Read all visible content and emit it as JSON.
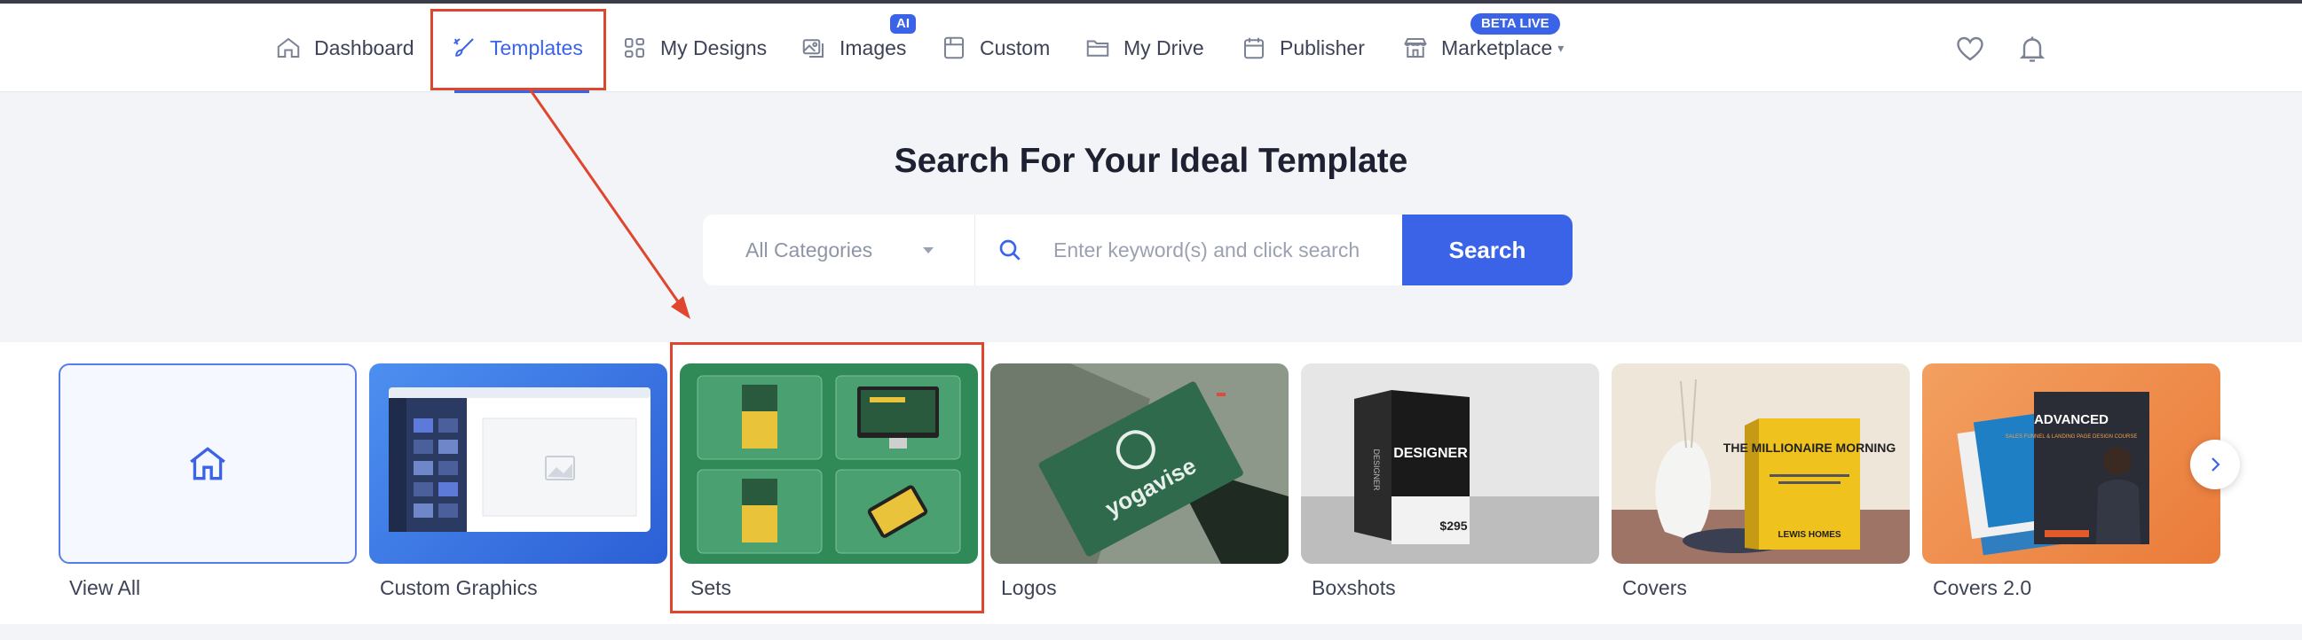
{
  "nav": {
    "items": [
      {
        "label": "Dashboard",
        "icon": "home-icon"
      },
      {
        "label": "Templates",
        "icon": "paint-brush-icon",
        "active": true
      },
      {
        "label": "My Designs",
        "icon": "grid-icon"
      },
      {
        "label": "Images",
        "icon": "images-icon",
        "badge": "AI"
      },
      {
        "label": "Custom",
        "icon": "custom-icon"
      },
      {
        "label": "My Drive",
        "icon": "folder-icon"
      },
      {
        "label": "Publisher",
        "icon": "calendar-icon"
      },
      {
        "label": "Marketplace",
        "icon": "store-icon",
        "badge": "BETA LIVE"
      }
    ],
    "right_icons": [
      "heart-icon",
      "bell-icon"
    ]
  },
  "hero": {
    "title": "Search For Your Ideal Template"
  },
  "search": {
    "category": "All Categories",
    "placeholder": "Enter keyword(s) and click search",
    "button": "Search"
  },
  "categories": [
    {
      "label": "View All"
    },
    {
      "label": "Custom Graphics"
    },
    {
      "label": "Sets"
    },
    {
      "label": "Logos"
    },
    {
      "label": "Boxshots"
    },
    {
      "label": "Covers"
    },
    {
      "label": "Covers 2.0"
    }
  ],
  "thumb_text": {
    "logo_brand": "yogavise",
    "box_title": "DESIGNER",
    "box_price": "$295",
    "cover_title": "THE MILLIONAIRE MORNING",
    "cover_author": "LEWIS HOMES",
    "cover2_title": "ADVANCED",
    "cover2_sub": "SALES FUNNEL & LANDING PAGE DESIGN COURSE"
  },
  "colors": {
    "accent": "#3b63e8",
    "annotation": "#e0452e"
  }
}
